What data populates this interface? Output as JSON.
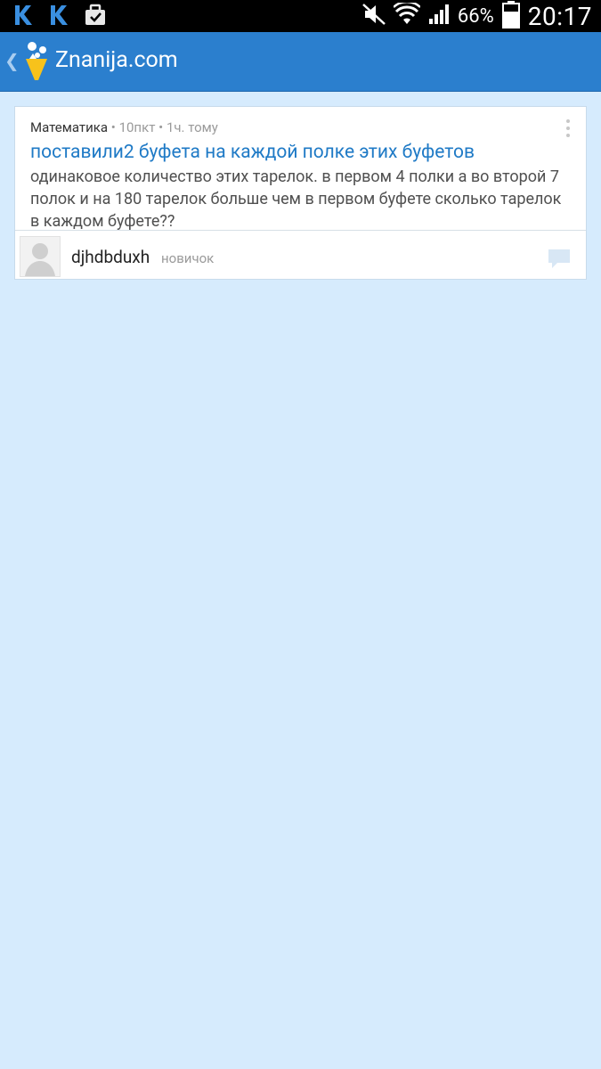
{
  "status_bar": {
    "battery": "66%",
    "time": "20:17",
    "left_icons": [
      "vk-icon",
      "vk-icon",
      "briefcase-icon"
    ],
    "right_icons": [
      "mute-icon",
      "wifi-icon",
      "signal-icon",
      "battery-icon"
    ]
  },
  "app_bar": {
    "title": "Znanija.com",
    "color": "#2b7fce"
  },
  "question": {
    "subject": "Математика",
    "points": "10пкт",
    "time_ago": "1ч. тому",
    "separator": "•",
    "title": "поставили2 буфета на каждой полке этих буфетов",
    "body": "одинаковое количество этих тарелок. в первом 4 полки а во второй 7 полок и на 180 тарелок больше чем в первом буфете сколько тарелок в каждом буфете??",
    "author": {
      "name": "djhdbduxh",
      "rank": "новичок"
    }
  },
  "colors": {
    "background": "#d6ebfd",
    "link": "#1f7ac6"
  }
}
